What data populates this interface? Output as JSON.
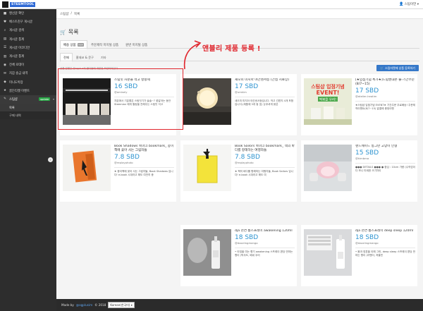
{
  "brand": {
    "label": "STEEMTOOL"
  },
  "header": {
    "user": "스팀이언",
    "caret": "▾"
  },
  "sidebar": {
    "items": [
      {
        "label": "앤선글 확인",
        "icon": "■"
      },
      {
        "label": "베스트친구 게시글",
        "icon": "♥"
      },
      {
        "label": "게시글 검색",
        "icon": "⌕"
      },
      {
        "label": "게시글 통계",
        "icon": "▤"
      },
      {
        "label": "게시글 아코디언",
        "icon": "☰"
      },
      {
        "label": "게시글 통계",
        "icon": "▥"
      },
      {
        "label": "전체 로데이",
        "icon": "◉"
      },
      {
        "label": "지갑 송금 내역",
        "icon": "✉"
      },
      {
        "label": "미니도박장",
        "icon": "◆"
      },
      {
        "label": "골든티켓 이벤트",
        "icon": "★"
      },
      {
        "label": "스팀샵",
        "icon": "✎",
        "badge": "update"
      }
    ],
    "sub_items": [
      {
        "label": "목록"
      },
      {
        "label": "구매 내역"
      }
    ],
    "collapse_icon": "‹"
  },
  "breadcrumb": {
    "home": "스팀샵",
    "sep": "/",
    "current": "목록"
  },
  "page": {
    "title": "목록",
    "title_icon": "🛒"
  },
  "category_tabs": [
    "배송 상품",
    "주문제작 미지털 상품",
    "원번 미지털 상품"
  ],
  "category_tab_new_badge": "new",
  "sub_tabs": [
    "전체",
    "홈데코 & 문구",
    "기타"
  ],
  "announcement": "앤블리 제품 등록 !",
  "hint": "상품 앞면은 @ogplus의 판다들에 개발된 보관되어있다.",
  "register_button": "스팀마켓에 상품 등록하기",
  "products": [
    {
      "title": "스팀잇 차분을 석고 방향제",
      "price": "16 SBD",
      "seller": "@amisely",
      "desc": "차분에서 기분좋은 스팀잇기가 솔솔~? 꽃같아는 동안 Steemian 에게 힐링을 전해주는 스팀잇 석고"
    },
    {
      "title": "새오미 미지아 야간센서등 (간접 지료장)",
      "price": "17 SBD",
      "seller": "@umkim",
      "desc": "새오미 미지아 야간센서등입니다. 작고 간편지 4개 포함입니다.(제품에 3개 동 호) 눈부셔게 밝은"
    },
    {
      "title": "[★입점기념 특가★]드립벤대폰 줄-기간주문(8/7~15)",
      "price": "17 SBD",
      "seller": "@atelier-heatim",
      "desc": "★스팀샵 입점기념 EVENT★ 기간주문 무료배송! 주문제작이벤트(8/7~15) 말결에 증정이벤"
    },
    {
      "title": "Book Shadows 북마크 bookmark_ 종이책에 꽂아 사는 그림자들",
      "price": "7.8 SBD",
      "seller": "@replayphoto",
      "desc": "★ 종이책에 꽂아 사는 그림자들, Book Shadows 입니다! e-book 시대라고 해도 여전히 종"
    },
    {
      "title": "Book Sailors 북마크 bookmark_ 책의 바다를 항해하는 여행자들",
      "price": "7.8 SBD",
      "seller": "@replayphoto",
      "desc": "★ 책의 바다를 항해하는 여행자들, Book Sailors 입니다! e-book 시대라고 해도 여"
    },
    {
      "title": "핸드메이드 동그란 고양이 인형",
      "price": "15 SBD",
      "seller": "@kimbma",
      "desc": "●●● DETAILS ●●● ● 중심 : 10cm 가량 (수작업이다 보니 미세한 크기차이"
    },
    {
      "title": "dja 천연 룸스프레이 awakening 120ml",
      "price": "18 SBD",
      "seller": "@dazzlingmango",
      "desc": "• 아침을 여는 향기 awakening 스프레이 편당 만마는 향이 (박무도, 베네 우리"
    },
    {
      "title": "dja 천연 룸스프레이 deep sleep 120ml",
      "price": "18 SBD",
      "seller": "@dazzlingmango",
      "desc": "• 몸과 영혼을 이해 그린, deep sleep 스프레이 편당 만마는 향이 (라벤더, 처블린"
    }
  ],
  "footer": {
    "made_by": "Made by",
    "author": "@ogplusim",
    "year": "© 2018",
    "language": "Korean(한국어) ▾"
  }
}
